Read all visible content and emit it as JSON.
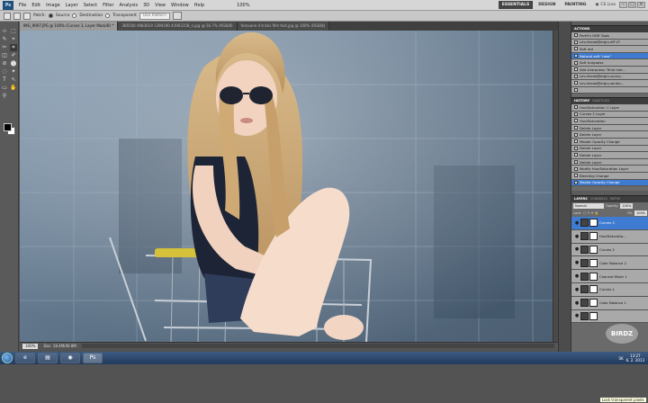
{
  "menubar": {
    "logo": "Ps",
    "items": [
      "File",
      "Edit",
      "Image",
      "Layer",
      "Select",
      "Filter",
      "Analysis",
      "3D",
      "View",
      "Window",
      "Help"
    ],
    "zoom": "100%",
    "workspaces": [
      "ESSENTIALS",
      "DESIGN",
      "PAINTING"
    ],
    "cs_live": "CS Live",
    "window_controls": [
      "–",
      "□",
      "×"
    ]
  },
  "options": {
    "patch_label": "Patch:",
    "source_label": "Source",
    "destination_label": "Destination",
    "transparent_label": "Transparent",
    "use_pattern": "Use Pattern"
  },
  "tabs": [
    {
      "label": "IMG_9907.JPG @ 100% (Curves 3, Layer Mask/8) *",
      "active": true
    },
    {
      "label": "366500 4983619 1390190 43903158_n.jpg @ 56.7% (RGB/8)",
      "active": false
    },
    {
      "label": "ferovane 4 tricks film fest.jpg @ 100% (RGB/8)",
      "active": false
    }
  ],
  "tools": [
    "⊹",
    "⬚",
    "✎",
    "⌖",
    "✂",
    "⌗",
    "◫",
    "✐",
    "⊘",
    "⬤",
    "◌",
    "✦",
    "T",
    "↖",
    "▭",
    "✋",
    "⚲"
  ],
  "status": {
    "zoom": "100%",
    "doc": "Doc: 18.4M/40.8M"
  },
  "actions": {
    "tabs": [
      "ACTIONS"
    ],
    "items": [
      {
        "label": "Portfi's HDR Tools",
        "hl": false
      },
      {
        "label": "Lev.ehead@ergiu.eff V?",
        "hl": false
      },
      {
        "label": "Soft red",
        "hl": false
      },
      {
        "label": "Natural soft \"new\"",
        "hl": true
      },
      {
        "label": "Soft turquoise",
        "hl": false
      },
      {
        "label": "Add sharpness \"final mer...",
        "hl": false
      },
      {
        "label": "Lev.ehead@ergiu.sunny...",
        "hl": false
      },
      {
        "label": "Lev.ehead@ergiu.winter...",
        "hl": false
      },
      {
        "label": "",
        "hl": false
      }
    ]
  },
  "history": {
    "tabs": [
      "HISTORY",
      "SWATCHES"
    ],
    "items": [
      {
        "label": "Hue/Saturation 1 Layer",
        "hl": false
      },
      {
        "label": "Curves 2 Layer",
        "hl": false
      },
      {
        "label": "Hue/Saturation",
        "hl": false
      },
      {
        "label": "Delete Layer",
        "hl": false
      },
      {
        "label": "Delete Layer",
        "hl": false
      },
      {
        "label": "Master Opacity Change",
        "hl": false
      },
      {
        "label": "Delete Layer",
        "hl": false
      },
      {
        "label": "Delete Layer",
        "hl": false
      },
      {
        "label": "Delete Layer",
        "hl": false
      },
      {
        "label": "Modify Hue/Saturation Layer",
        "hl": false
      },
      {
        "label": "Blending Change",
        "hl": false
      },
      {
        "label": "Master Opacity Change",
        "hl": true
      }
    ]
  },
  "layers": {
    "tabs": [
      "LAYERS",
      "CHANNELS",
      "PATHS"
    ],
    "blend_mode": "Normal",
    "opacity_label": "Opacity:",
    "opacity": "100%",
    "lock_label": "Lock:",
    "fill_label": "Fill:",
    "fill": "100%",
    "tooltip": "Lock transparent pixels",
    "items": [
      {
        "label": "Curves 3",
        "hl": true
      },
      {
        "label": "Hue/Saturatio...",
        "hl": false
      },
      {
        "label": "Curves 2",
        "hl": false
      },
      {
        "label": "Color Balance 2",
        "hl": false
      },
      {
        "label": "Channel Mixer 1",
        "hl": false
      },
      {
        "label": "Curves 1",
        "hl": false
      },
      {
        "label": "Color Balance 1",
        "hl": false
      },
      {
        "label": "",
        "hl": false
      }
    ]
  },
  "watermark": "BIRDZ",
  "taskbar": {
    "buttons": [
      "e",
      "▤",
      "◉",
      "Ps"
    ],
    "lang": "SK",
    "time": "13:27",
    "date": "6. 2. 2013"
  }
}
